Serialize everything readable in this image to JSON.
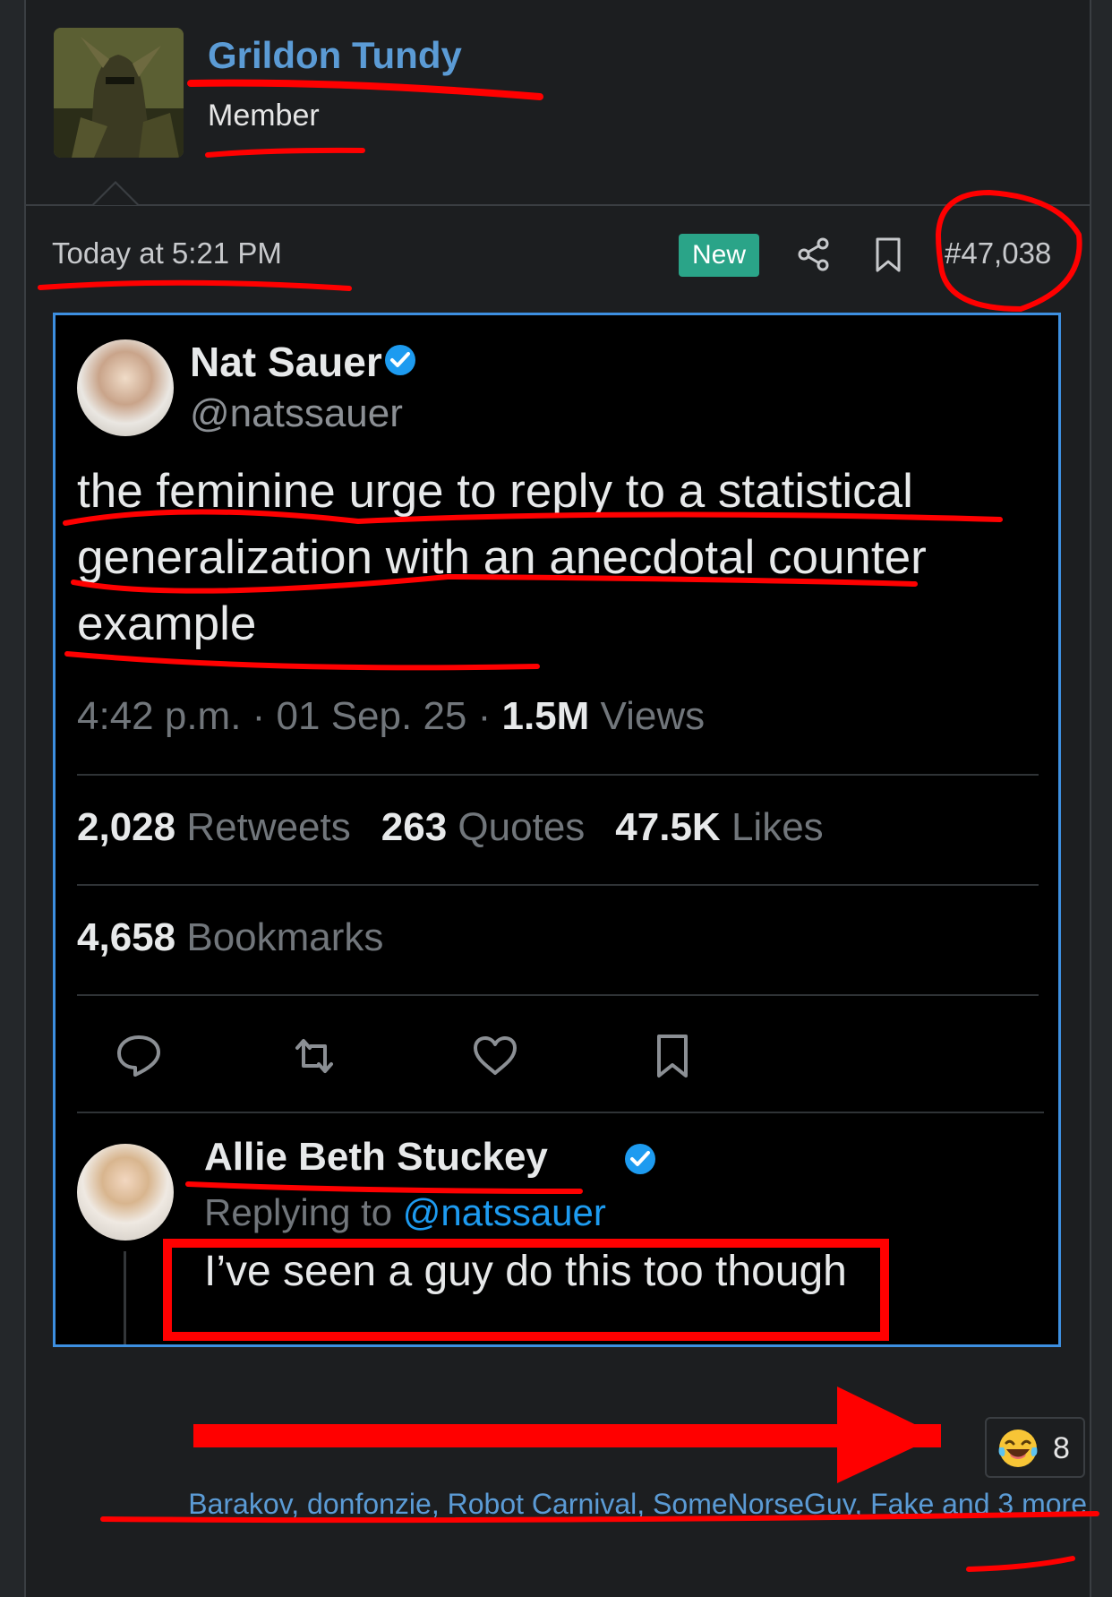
{
  "author": {
    "name": "Grildon Tundy",
    "title": "Member"
  },
  "post_meta": {
    "timestamp": "Today at 5:21 PM",
    "new_badge": "New",
    "post_number": "#47,038"
  },
  "tweet": {
    "name": "Nat Sauer",
    "handle": "@natssauer",
    "text": "the feminine urge to reply to a statistical generalization with an anecdotal counter example",
    "meta_time": "4:42 p.m. · 01 Sep. 25 · ",
    "views_count": "1.5M",
    "views_label": " Views",
    "stats": {
      "retweets": "2,028",
      "retweets_label": "Retweets",
      "quotes": "263",
      "quotes_label": "Quotes",
      "likes": "47.5K",
      "likes_label": "Likes",
      "bookmarks": "4,658",
      "bookmarks_label": "Bookmarks"
    }
  },
  "reply": {
    "name": "Allie Beth Stuckey",
    "replying_prefix": "Replying to ",
    "replying_handle": "@natssauer",
    "text": "I’ve seen a guy do this too though"
  },
  "reactions": {
    "emoji": "laughing-with-tears",
    "count": "8",
    "reactors_text": "Barakov, donfonzie, Robot Carnival, SomeNorseGuy, Fake and 3 more"
  },
  "colors": {
    "link": "#5b9bd5",
    "badge": "#2aa488",
    "embed_border": "#3d8fe0",
    "annotation": "#ff0000"
  }
}
